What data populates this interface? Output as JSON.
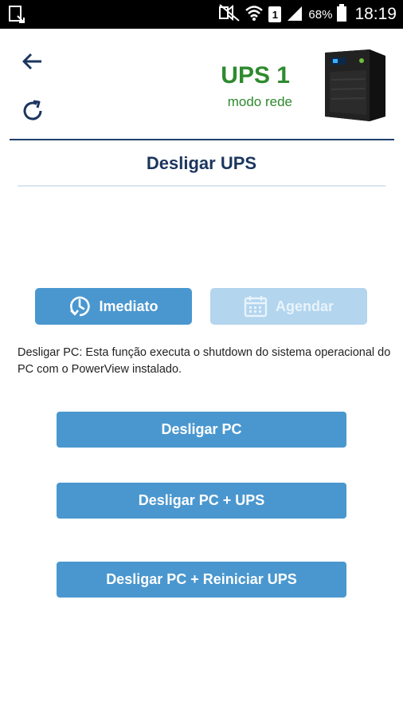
{
  "statusbar": {
    "battery": "68%",
    "time": "18:19",
    "sim_badge": "1",
    "icons": [
      "download-notification-icon",
      "mute-icon",
      "wifi-icon",
      "sim-icon",
      "signal-icon",
      "battery-icon"
    ]
  },
  "header": {
    "title": "UPS 1",
    "mode": "modo rede",
    "title_color": "#2e8a2e"
  },
  "section": {
    "title": "Desligar UPS"
  },
  "mode_tabs": [
    {
      "label": "Imediato",
      "icon": "clock-icon",
      "active": true
    },
    {
      "label": "Agendar",
      "icon": "calendar-icon",
      "active": false
    }
  ],
  "description": "Desligar PC: Esta função executa o shutdown do sistema operacional do PC com o PowerView instalado.",
  "actions": [
    {
      "label": "Desligar PC"
    },
    {
      "label": "Desligar PC + UPS"
    },
    {
      "label": "Desligar PC + Reiniciar UPS"
    }
  ],
  "colors": {
    "accent": "#4a97cf",
    "accent_disabled": "#b3d5ee",
    "title_navy": "#1c355e",
    "status_green": "#2e8a2e"
  }
}
